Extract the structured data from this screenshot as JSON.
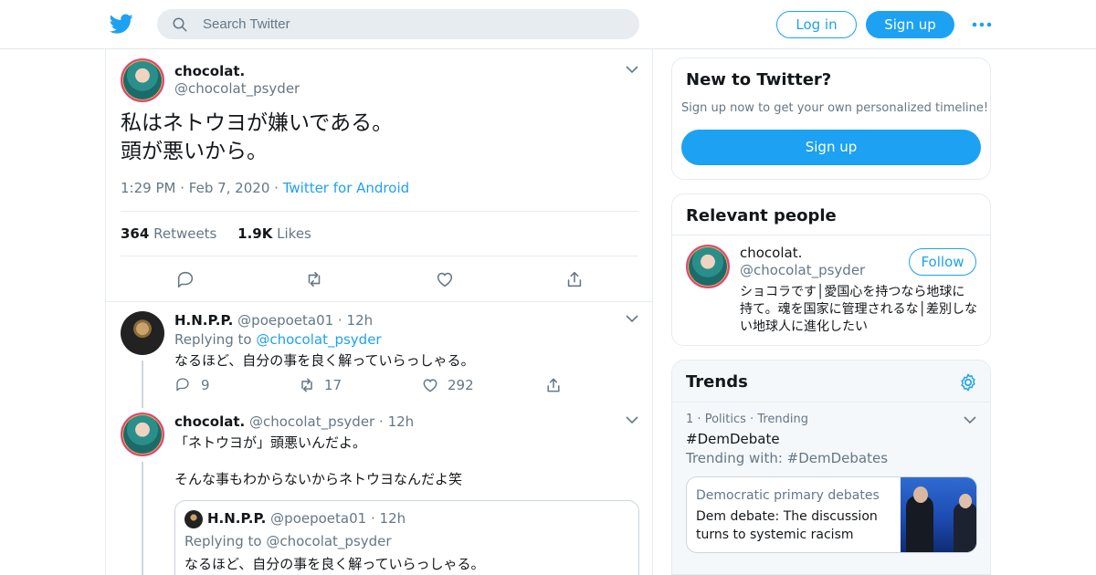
{
  "header": {
    "search_placeholder": "Search Twitter",
    "login_label": "Log in",
    "signup_label": "Sign up",
    "logo_icon": "twitter-bird-icon",
    "more_icon": "more-dots-icon"
  },
  "main_tweet": {
    "name": "chocolat.",
    "handle": "@chocolat_psyder",
    "text_line1": "私はネトウヨが嫌いである。",
    "text_line2": "頭が悪いから。",
    "time": "1:29 PM",
    "date": "Feb 7, 2020",
    "source": "Twitter for Android",
    "retweets_count": "364",
    "retweets_label": "Retweets",
    "likes_count": "1.9K",
    "likes_label": "Likes"
  },
  "replies": [
    {
      "name": "H.N.P.P.",
      "handle": "@poepoeta01",
      "time": "12h",
      "replying_prefix": "Replying to",
      "replying_to": "@chocolat_psyder",
      "text": "なるほど、自分の事を良く解っていらっしゃる。",
      "reply_count": "9",
      "retweet_count": "17",
      "like_count": "292"
    },
    {
      "name": "chocolat.",
      "handle": "@chocolat_psyder",
      "time": "12h",
      "text_line1": "「ネトウヨが」頭悪いんだよ。",
      "text_line2": "そんな事もわからないからネトウヨなんだよ笑",
      "quoted": {
        "name": "H.N.P.P.",
        "handle": "@poepoeta01",
        "time": "12h",
        "replying": "Replying to @chocolat_psyder",
        "text": "なるほど、自分の事を良く解っていらっしゃる。"
      }
    }
  ],
  "sidebar": {
    "new_title": "New to Twitter?",
    "new_subtitle": "Sign up now to get your own personalized timeline!",
    "new_signup": "Sign up",
    "relevant_title": "Relevant people",
    "person": {
      "name": "chocolat.",
      "handle": "@chocolat_psyder",
      "follow_label": "Follow",
      "bio": "ショコラです│愛国心を持つなら地球に持て。魂を国家に管理されるな│差別しない地球人に進化したい"
    },
    "trends_title": "Trends",
    "trend": {
      "rank": "1",
      "category": "Politics",
      "status": "Trending",
      "name": "#DemDebate",
      "with": "Trending with: #DemDebates",
      "card_category": "Democratic primary debates",
      "card_title": "Dem debate: The discussion turns to systemic racism"
    }
  },
  "colors": {
    "brand": "#1da1f2",
    "text": "#14171a",
    "secondary": "#657786",
    "border": "#e6ecf0"
  }
}
